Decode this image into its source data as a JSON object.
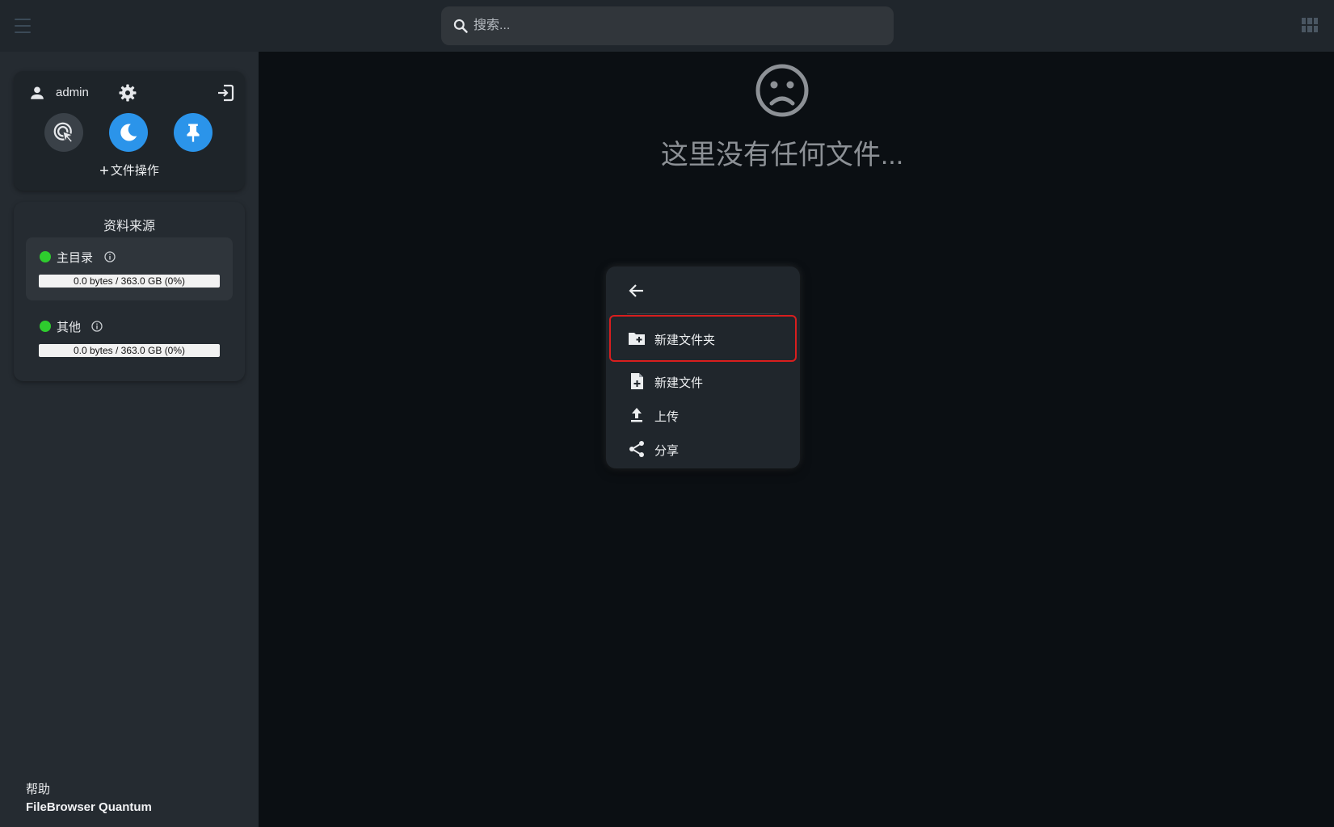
{
  "topbar": {
    "search_placeholder": "搜索..."
  },
  "sidebar": {
    "user": {
      "username": "admin"
    },
    "file_operations_label": "文件操作",
    "sources": {
      "title": "资料来源",
      "items": [
        {
          "name": "主目录",
          "status": "online",
          "usage_text": "0.0 bytes / 363.0 GB (0%)",
          "usage_percent": 0
        },
        {
          "name": "其他",
          "status": "online",
          "usage_text": "0.0 bytes / 363.0 GB (0%)",
          "usage_percent": 0
        }
      ]
    },
    "help_label": "帮助",
    "app_name": "FileBrowser Quantum"
  },
  "main": {
    "empty_message": "这里没有任何文件..."
  },
  "context_menu": {
    "items": [
      {
        "label": "新建文件夹",
        "icon": "create-new-folder-icon",
        "highlighted": true
      },
      {
        "label": "新建文件",
        "icon": "note-add-icon"
      },
      {
        "label": "上传",
        "icon": "upload-icon"
      },
      {
        "label": "分享",
        "icon": "share-icon"
      }
    ]
  },
  "colors": {
    "accent": "#2b94ea",
    "status_online": "#2ecc2e",
    "highlight_border": "#d81e1e",
    "sidebar_bg": "#252b31",
    "main_bg": "#0b0f13"
  }
}
